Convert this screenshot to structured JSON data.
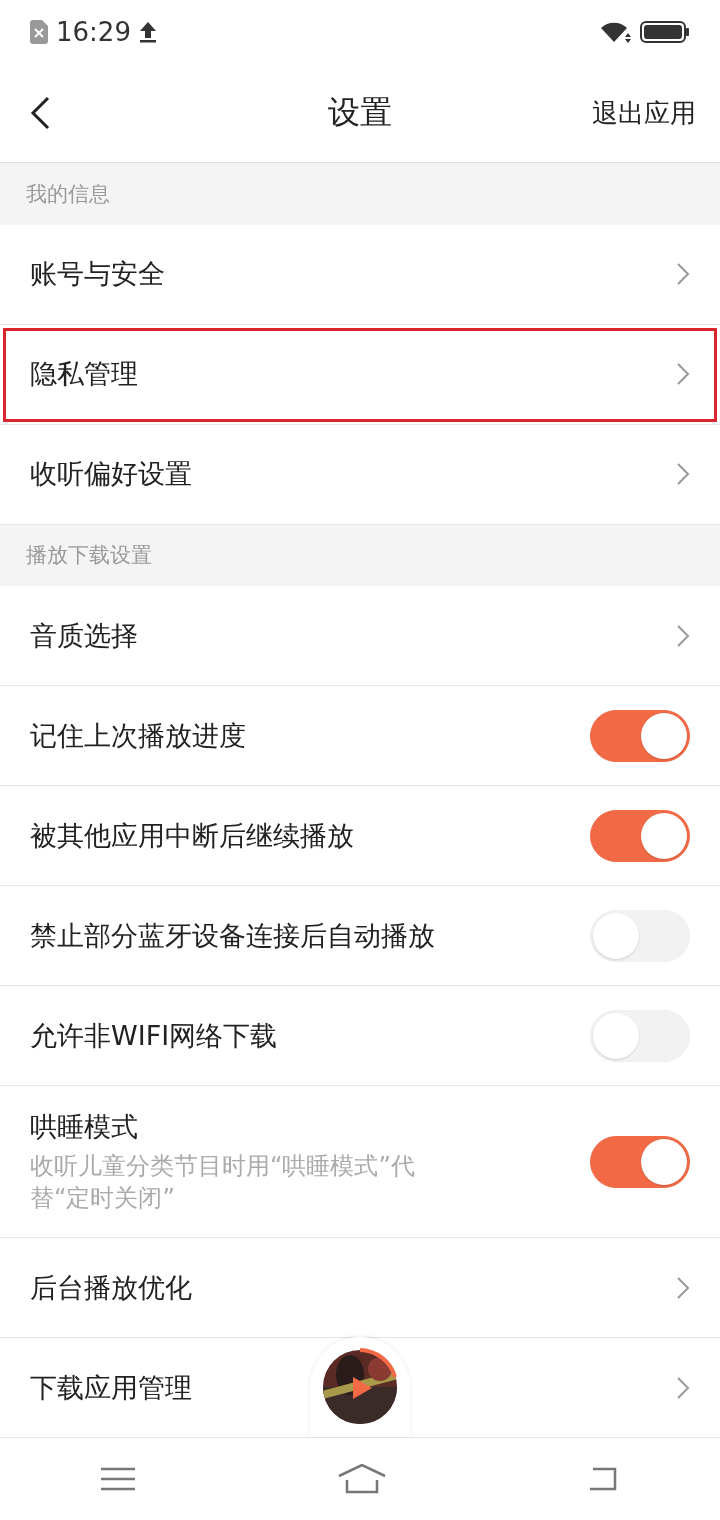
{
  "status_bar": {
    "time": "16:29"
  },
  "nav": {
    "title": "设置",
    "action": "退出应用"
  },
  "sections": [
    {
      "title": "我的信息",
      "rows": [
        {
          "kind": "link",
          "label": "账号与安全",
          "highlighted": false
        },
        {
          "kind": "link",
          "label": "隐私管理",
          "highlighted": true
        },
        {
          "kind": "link",
          "label": "收听偏好设置",
          "highlighted": false
        }
      ]
    },
    {
      "title": "播放下载设置",
      "rows": [
        {
          "kind": "link",
          "label": "音质选择",
          "highlighted": false
        },
        {
          "kind": "toggle",
          "label": "记住上次播放进度",
          "on": true,
          "highlighted": false
        },
        {
          "kind": "toggle",
          "label": "被其他应用中断后继续播放",
          "on": true,
          "highlighted": false
        },
        {
          "kind": "toggle",
          "label": "禁止部分蓝牙设备连接后自动播放",
          "on": false,
          "highlighted": false
        },
        {
          "kind": "toggle",
          "label": "允许非WIFI网络下载",
          "on": false,
          "highlighted": false
        },
        {
          "kind": "toggle",
          "label": "哄睡模式",
          "description": "收听儿童分类节目时用“哄睡模式”代替“定时关闭”",
          "on": true,
          "highlighted": false
        },
        {
          "kind": "link",
          "label": "后台播放优化",
          "highlighted": false
        },
        {
          "kind": "link",
          "label": "下载应用管理",
          "highlighted": false
        }
      ]
    }
  ]
}
